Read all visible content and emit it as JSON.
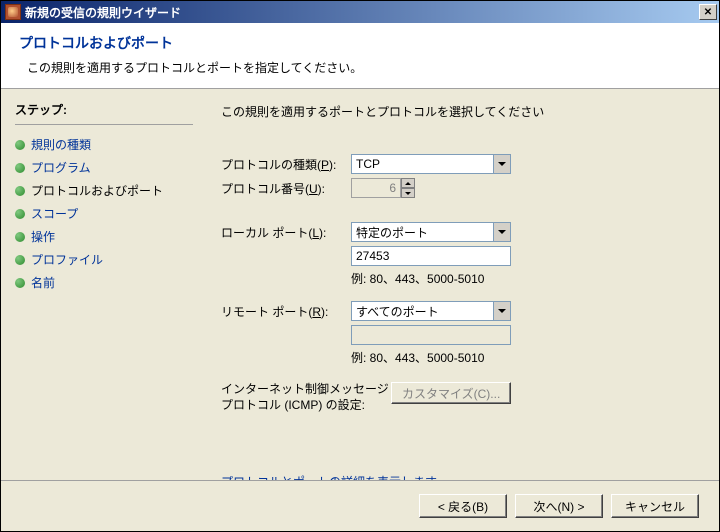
{
  "window": {
    "title": "新規の受信の規則ウイザード"
  },
  "header": {
    "title": "プロトコルおよびポート",
    "description": "この規則を適用するプロトコルとポートを指定してください。"
  },
  "sidebar": {
    "heading": "ステップ:",
    "items": [
      {
        "label": "規則の種類"
      },
      {
        "label": "プログラム"
      },
      {
        "label": "プロトコルおよびポート"
      },
      {
        "label": "スコープ"
      },
      {
        "label": "操作"
      },
      {
        "label": "プロファイル"
      },
      {
        "label": "名前"
      }
    ]
  },
  "main": {
    "instruction": "この規則を適用するポートとプロトコルを選択してください",
    "protocol_type_label": "プロトコルの種類(",
    "protocol_type_accel": "P",
    "protocol_type_close": "):",
    "protocol_type_value": "TCP",
    "protocol_number_label": "プロトコル番号(",
    "protocol_number_accel": "U",
    "protocol_number_close": "):",
    "protocol_number_value": "6",
    "local_port_label": "ローカル ポート(",
    "local_port_accel": "L",
    "local_port_close": "):",
    "local_port_select": "特定のポート",
    "local_port_value": "27453",
    "local_port_example": "例: 80、443、5000-5010",
    "remote_port_label": "リモート ポート(",
    "remote_port_accel": "R",
    "remote_port_close": "):",
    "remote_port_select": "すべてのポート",
    "remote_port_value": "",
    "remote_port_example": "例: 80、443、5000-5010",
    "icmp_label": "インターネット制御メッセージ プロトコル (ICMP) の設定:",
    "icmp_button": "カスタマイズ(C)...",
    "details_link": "プロトコルとポートの詳細を表示します"
  },
  "footer": {
    "back": "< 戻る(B)",
    "next": "次へ(N) >",
    "cancel": "キャンセル"
  }
}
